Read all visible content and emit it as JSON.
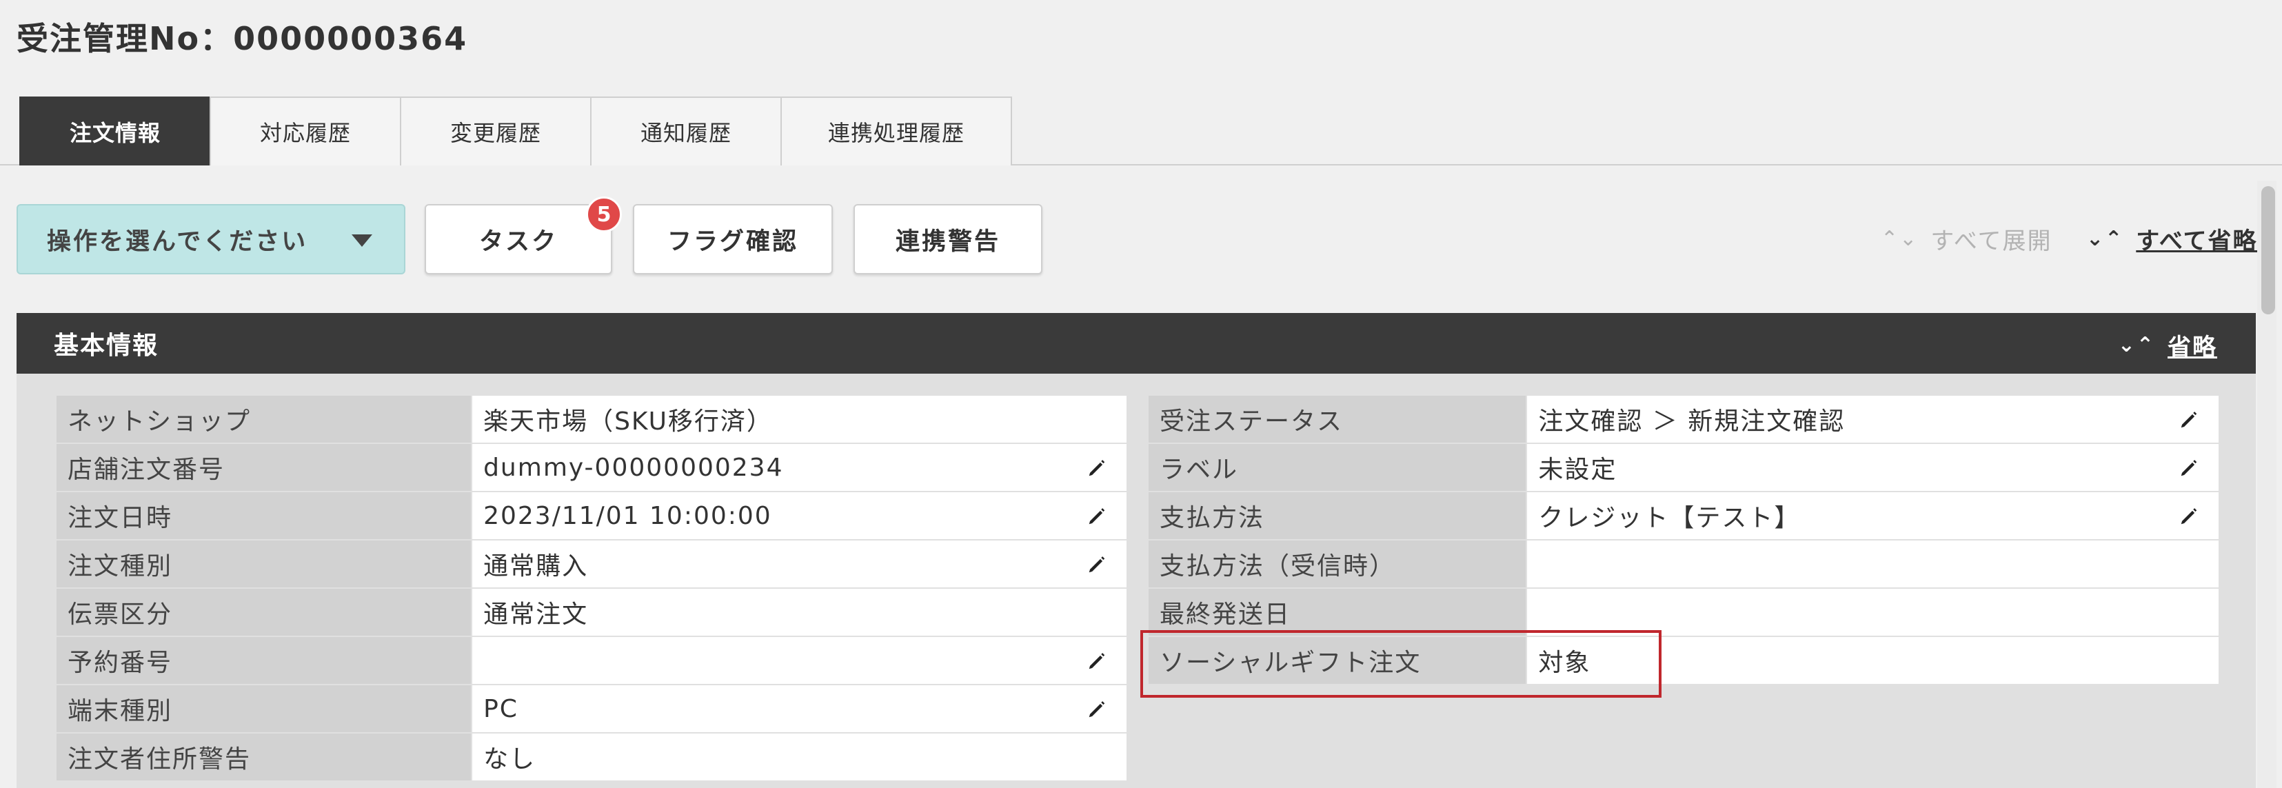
{
  "header": {
    "title": "受注管理No：0000000364"
  },
  "tabs": [
    {
      "label": "注文情報",
      "active": true
    },
    {
      "label": "対応履歴",
      "active": false
    },
    {
      "label": "変更履歴",
      "active": false
    },
    {
      "label": "通知履歴",
      "active": false
    },
    {
      "label": "連携処理履歴",
      "active": false
    }
  ],
  "toolbar": {
    "operation_select": "操作を選んでください",
    "task_label": "タスク",
    "task_badge": "5",
    "flag_label": "フラグ確認",
    "warning_label": "連携警告",
    "expand_all": "すべて展開",
    "collapse_all": "すべて省略"
  },
  "section": {
    "title": "基本情報",
    "collapse": "省略",
    "left_rows": [
      {
        "label": "ネットショップ",
        "value": "楽天市場（SKU移行済）",
        "editable": false
      },
      {
        "label": "店舗注文番号",
        "value": "dummy-00000000234",
        "editable": true
      },
      {
        "label": "注文日時",
        "value": "2023/11/01 10:00:00",
        "editable": true
      },
      {
        "label": "注文種別",
        "value": "通常購入",
        "editable": true
      },
      {
        "label": "伝票区分",
        "value": "通常注文",
        "editable": false
      },
      {
        "label": "予約番号",
        "value": "",
        "editable": true
      },
      {
        "label": "端末種別",
        "value": "PC",
        "editable": true
      },
      {
        "label": "注文者住所警告",
        "value": "なし",
        "editable": false
      }
    ],
    "right_rows": [
      {
        "label": "受注ステータス",
        "value": "注文確認 ＞ 新規注文確認",
        "editable": true
      },
      {
        "label": "ラベル",
        "value": "未設定",
        "editable": true
      },
      {
        "label": "支払方法",
        "value": "クレジット【テスト】",
        "editable": true
      },
      {
        "label": "支払方法（受信時）",
        "value": "",
        "editable": false
      },
      {
        "label": "最終発送日",
        "value": "",
        "editable": false
      },
      {
        "label": "ソーシャルギフト注文",
        "value": "対象",
        "editable": false
      }
    ]
  },
  "colors": {
    "header_dark": "#3a3a3a",
    "select_bg": "#bfe6e6",
    "badge": "#e04848",
    "highlight": "#c0272d"
  }
}
